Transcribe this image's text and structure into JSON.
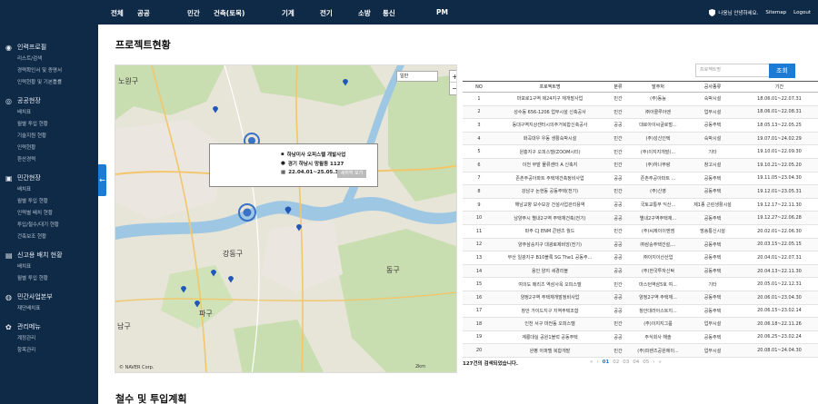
{
  "topnav": {
    "items": [
      "전체",
      "공공",
      "민간",
      "건축(토목)",
      "기계",
      "전기",
      "소방",
      "통신",
      "PM"
    ],
    "user_greeting": "나웅님 안녕하세요.",
    "sitemap": "Sitemap",
    "logout": "Logout"
  },
  "sidebar": {
    "sections": [
      {
        "title": "인력프로필",
        "icon": "user-icon",
        "items": [
          "리스트/검색",
          "경력확인서 및 증명서",
          "인력현황 및 기본틀률"
        ]
      },
      {
        "title": "공공현장",
        "icon": "pin-icon",
        "items": [
          "배치표",
          "월별 투입 현황",
          "기술지원 현황",
          "인력현황",
          "환산경력"
        ]
      },
      {
        "title": "민간현장",
        "icon": "building-icon",
        "items": [
          "배치표",
          "월별 투입 현황",
          "인력별 배치 현황",
          "투입/철수/대기 현황",
          "건축보조 현황"
        ]
      },
      {
        "title": "신고용 배치 현황",
        "icon": "doc-icon",
        "items": [
          "배치표",
          "월별 투입 현황"
        ]
      },
      {
        "title": "민간사업본부",
        "icon": "org-icon",
        "items": [
          "재단배치표"
        ]
      },
      {
        "title": "관리메뉴",
        "icon": "gear-icon",
        "items": [
          "계정관리",
          "항목관리"
        ]
      }
    ],
    "collapse_label": "←"
  },
  "main": {
    "page_title": "프로젝트현황",
    "section_title": "철수 및 투입계획"
  },
  "map": {
    "select_value": "일반",
    "zoom_in": "+",
    "zoom_out": "−",
    "popup": {
      "name": "하남미사 오피스텔 개발사업",
      "address": "경기 하남시 망월동 1127",
      "period": "22.04.01~25.05.30",
      "detail_btn": "세히히 보기"
    },
    "credit": "© NAVER Corp.",
    "scale": "2km",
    "labels": [
      "노원구",
      "성동구",
      "강동구",
      "동구",
      "남구",
      "파구"
    ]
  },
  "table": {
    "search_placeholder": "프로젝트명",
    "search_btn": "조회",
    "headers": [
      "NO",
      "프로젝트명",
      "분류",
      "발주처",
      "공사종류",
      "기간"
    ],
    "rows": [
      [
        "1",
        "마포로1구역 제24지구 재개발사업",
        "민간",
        "(주)동능",
        "숙박시설",
        "18.06.01~22.07.31"
      ],
      [
        "2",
        "성수동 656-1206 업무시설 신축공사",
        "민간",
        "㈜아콜루아엔",
        "업무시설",
        "18.06.01~22.08.31"
      ],
      [
        "3",
        "동대구역지상센터시의주거복합신축공사",
        "공공",
        "대로아이씨글로벌...",
        "공동주택",
        "18.05.13~22.05.25"
      ],
      [
        "4",
        "화곡대우 우동 생활숙박시설",
        "민간",
        "(주)성신인텍",
        "숙박시설",
        "19.07.01~24.02.29"
      ],
      [
        "5",
        "원흥지구 오피스텔(ZOOM시티)",
        "민간",
        "(주)이지지개발(...",
        "기타",
        "19.10.01~22.09.30"
      ],
      [
        "6",
        "이천 부발 물류센터 A 신축지",
        "민간",
        "(주)하나푸랑",
        "창고시설",
        "19.10.21~22.05.20"
      ],
      [
        "7",
        "존촌주공아파트 주택재건축정비사업",
        "공공",
        "존촌주공아파트 ...",
        "공동주택",
        "19.11.05~23.04.30"
      ],
      [
        "8",
        "강남구 논현동 공동주택(전기)",
        "민간",
        "(주)신영",
        "공동주택",
        "19.12.01~23.05.31"
      ],
      [
        "9",
        "해남교향 보수보강 건설사업관리용역",
        "공공",
        "국토교통부 익산...",
        "제1종 근린생활시설",
        "19.12.17~22.11.30"
      ],
      [
        "10",
        "남양주시 별내2구역 주택재건축(전기)",
        "공공",
        "별내2구역주택재...",
        "공동주택",
        "19.12.27~22.06.28"
      ],
      [
        "11",
        "파주 CJ ENM 콘텐츠 월드",
        "민간",
        "(주)씨제이이엔엠",
        "방송통신시설",
        "20.02.01~22.06.30"
      ],
      [
        "12",
        "양주삼숭지구 대광로제비앙(전기)",
        "공공",
        "㈜삼숭주택건설,...",
        "공동주택",
        "20.03.15~22.05.15"
      ],
      [
        "13",
        "부산 일광지구 B10블록 SG The1 공동주...",
        "공공",
        "㈜이지이산산업",
        "공동주택",
        "20.04.01~22.07.31"
      ],
      [
        "14",
        "용인 양지 세경리블",
        "공공",
        "(주)한국투자신탁",
        "공동주택",
        "20.04.13~22.11.30"
      ],
      [
        "15",
        "여의도 메리츠 역삼사옥 오피스텔",
        "민간",
        "마스턴역삼5호 여...",
        "기타",
        "20.05.01~22.12.31"
      ],
      [
        "16",
        "양정2구역 주택재개발정비사업",
        "공공",
        "양정2구역 주택재...",
        "공동주택",
        "20.06.01~23.04.30"
      ],
      [
        "17",
        "창안 가이드지구 지역주택조합",
        "공공",
        "창안대라아스트지...",
        "공동주택",
        "20.06.15~23.02.14"
      ],
      [
        "18",
        "인천 서구 마전동 오피스텔",
        "민간",
        "(주)이지지그룹",
        "업무시설",
        "20.06.18~22.11.26"
      ],
      [
        "19",
        "계룡대실 공원1블럭 공동주택",
        "공공",
        "주식회사 해솔",
        "공동주택",
        "20.06.25~23.02.24"
      ],
      [
        "20",
        "완평 아파텔 복합개발",
        "민간",
        "(주)피렌즈공원에이...",
        "업무시설",
        "20.08.01~24.04.30"
      ]
    ],
    "total_text": "127건의 검색되었습니다.",
    "pager": [
      "«",
      "‹",
      "01",
      "02",
      "03",
      "04",
      "05",
      "›",
      "»"
    ]
  },
  "colors": {
    "navy": "#0f2a47",
    "accent": "#1c7bd4"
  }
}
